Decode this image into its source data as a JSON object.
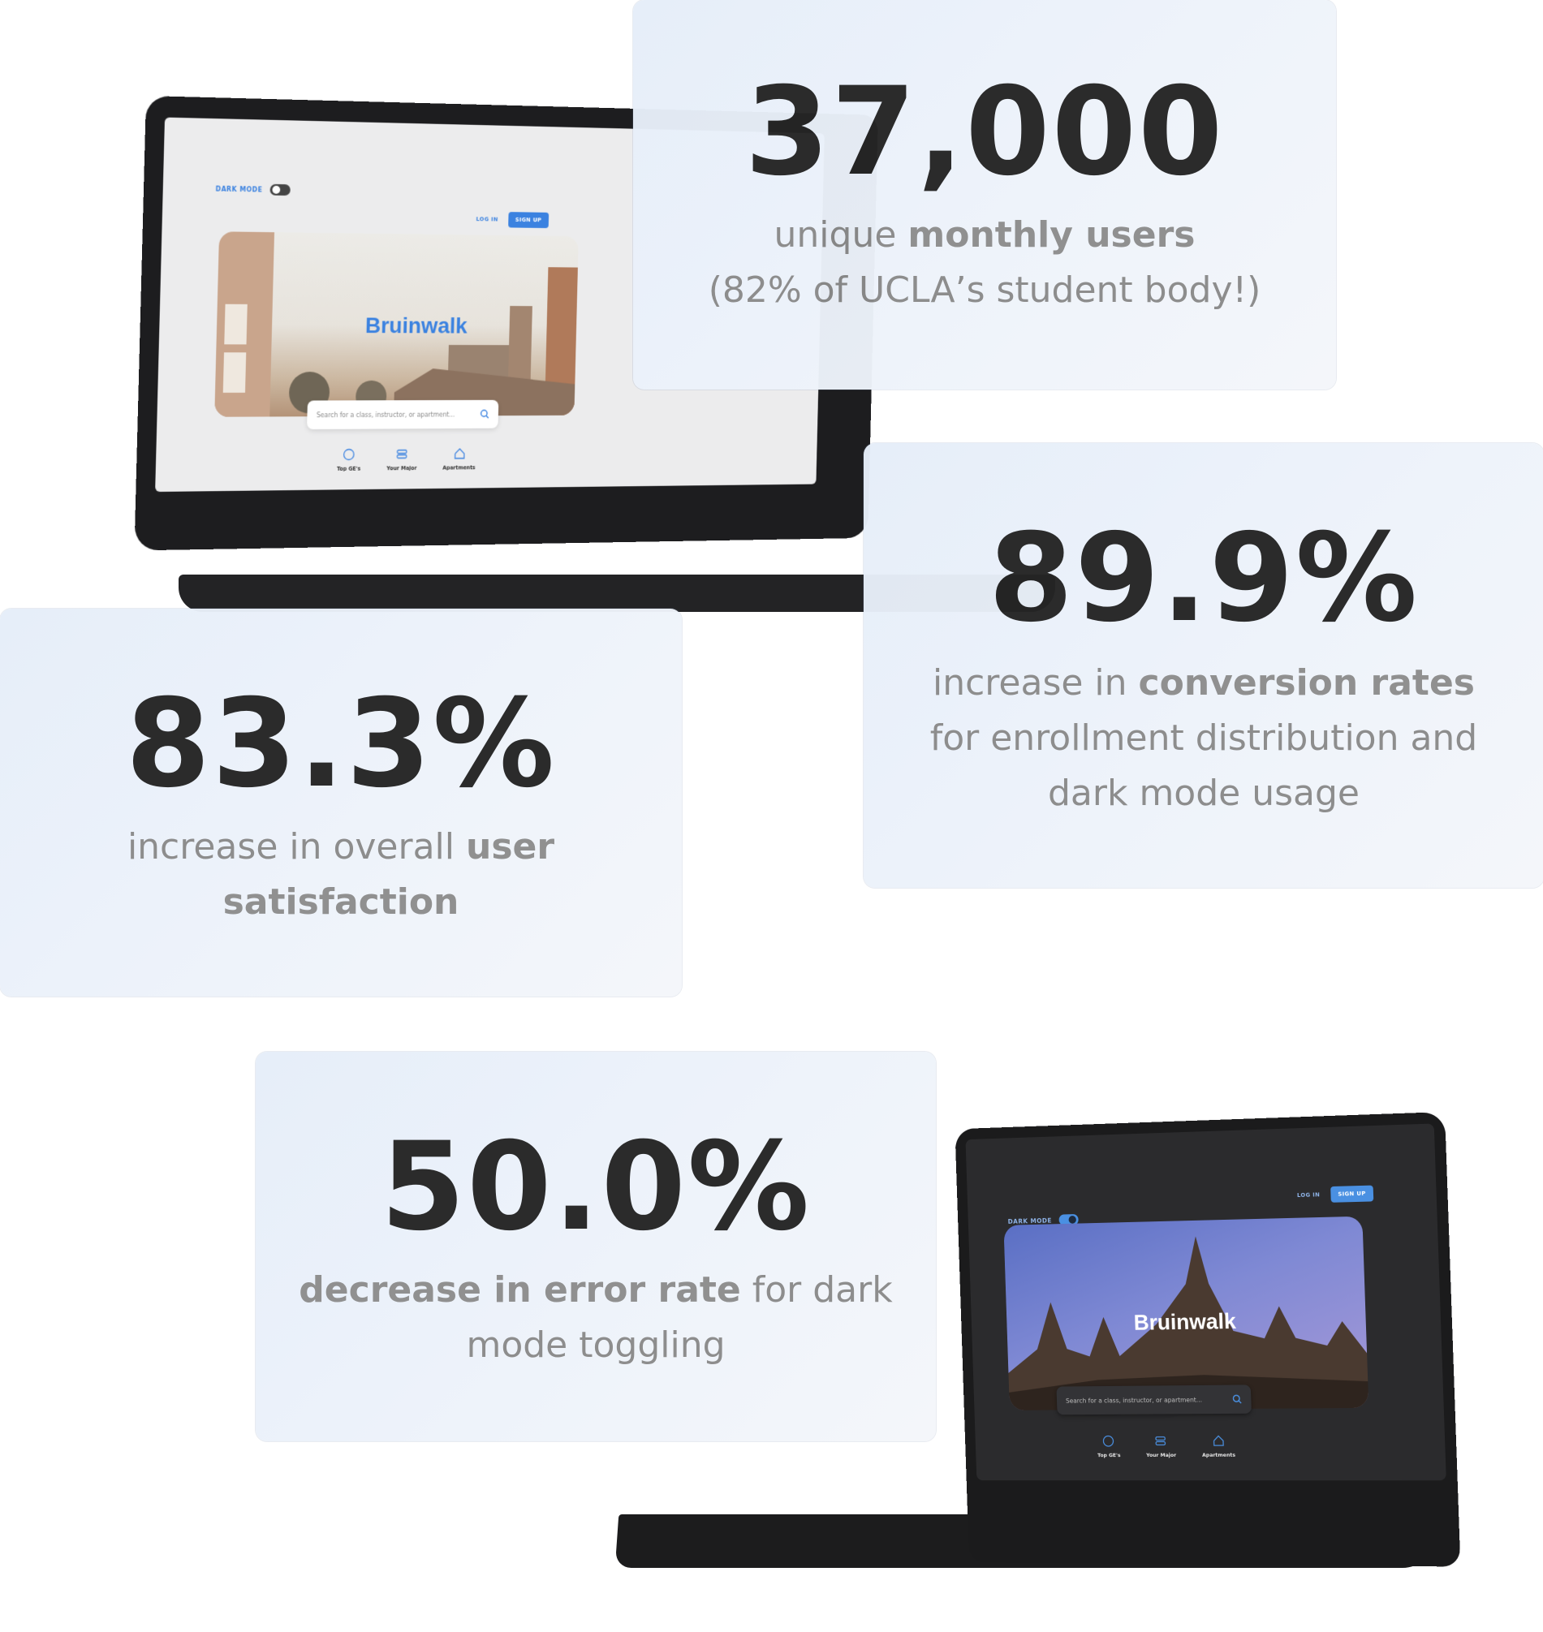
{
  "stats": [
    {
      "value": "37,000",
      "pre": "unique ",
      "bold": "monthly users",
      "post": "",
      "line2": "(82% of UCLA’s student body!)"
    },
    {
      "value": "89.9%",
      "pre": "increase in ",
      "bold": "conversion rates",
      "post": "",
      "line2": "for enrollment distribution and",
      "line3": "dark mode usage"
    },
    {
      "value": "83.3%",
      "pre": "increase in overall ",
      "bold": "user",
      "line2bold": "satisfaction"
    },
    {
      "value": "50.0%",
      "bold": "decrease in error rate",
      "post": " for dark",
      "line2": "mode toggling"
    }
  ],
  "light_site": {
    "dark_mode_label": "DARK MODE",
    "login": "LOG IN",
    "signup": "SIGN UP",
    "brand": "Bruinwalk",
    "search_placeholder": "Search for a class, instructor, or apartment...",
    "nav": [
      "Top GE's",
      "Your Major",
      "Apartments"
    ],
    "brand_color": "#3b82e0"
  },
  "dark_site": {
    "dark_mode_label": "DARK MODE",
    "login": "LOG IN",
    "signup": "SIGN UP",
    "brand": "Bruinwalk",
    "search_placeholder": "Search for a class, instructor, or apartment...",
    "nav": [
      "Top GE's",
      "Your Major",
      "Apartments"
    ],
    "accent_color": "#4a90e2"
  }
}
